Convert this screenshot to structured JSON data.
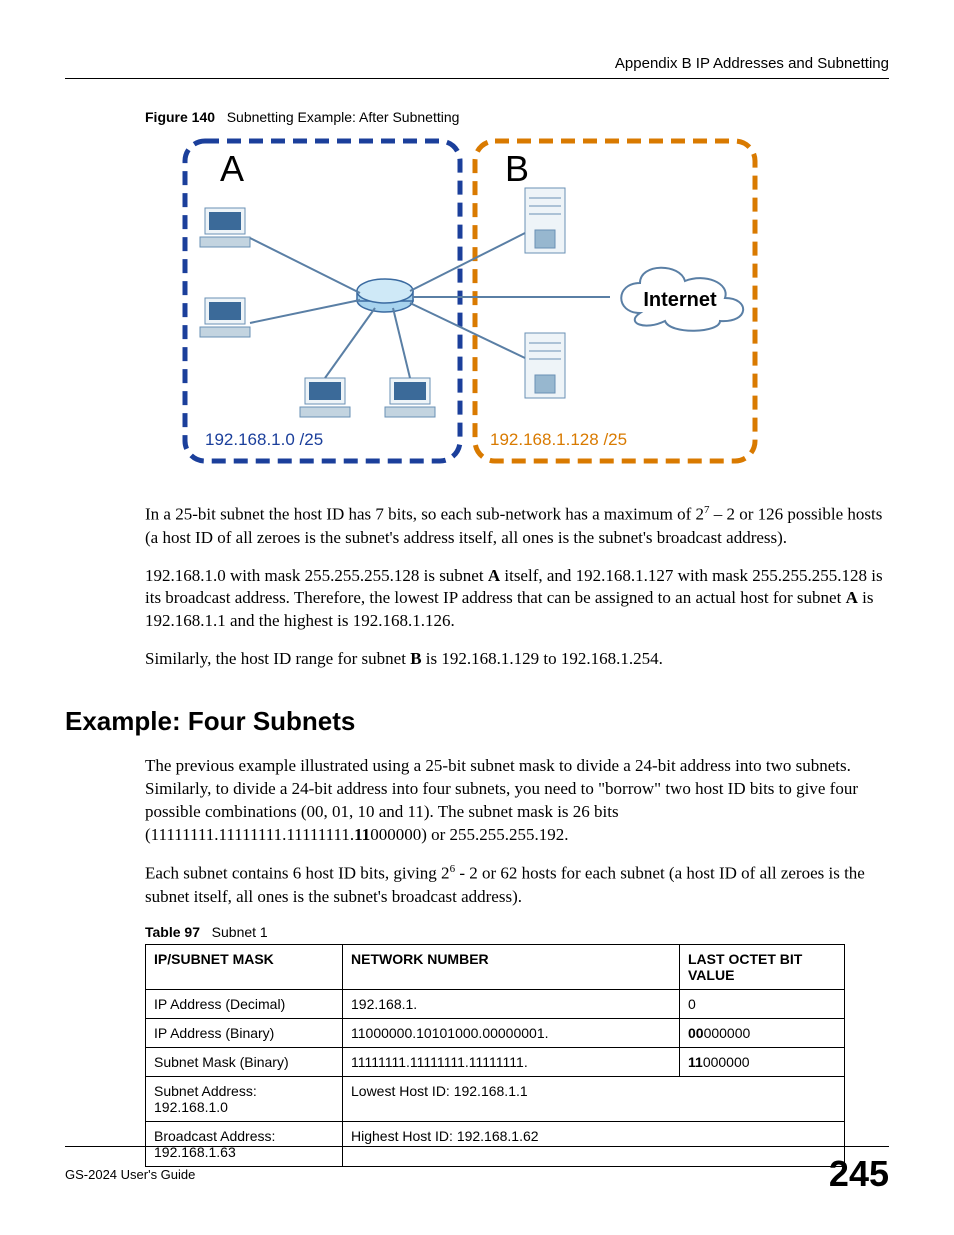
{
  "header": {
    "appendix_line": "Appendix B IP Addresses and Subnetting"
  },
  "figure": {
    "label": "Figure 140",
    "title": "Subnetting Example: After Subnetting",
    "box_a": "A",
    "box_b": "B",
    "subnet_a_ip": "192.168.1.0 /25",
    "subnet_b_ip": "192.168.1.128 /25",
    "cloud_label": "Internet"
  },
  "paragraphs": {
    "p1_a": "In a 25-bit subnet the host ID has 7 bits, so each sub-network has a maximum of 2",
    "p1_sup": "7",
    "p1_b": " – 2 or 126 possible hosts (a host ID of all zeroes is the subnet's address itself, all ones is the subnet's broadcast address).",
    "p2_a": "192.168.1.0 with mask 255.255.255.128 is subnet ",
    "p2_bold1": "A",
    "p2_b": " itself, and 192.168.1.127 with mask 255.255.255.128 is its broadcast address. Therefore, the lowest IP address that can be assigned to an actual host for subnet ",
    "p2_bold2": "A",
    "p2_c": " is 192.168.1.1 and the highest is 192.168.1.126.",
    "p3_a": "Similarly, the host ID range for subnet ",
    "p3_bold": "B",
    "p3_b": " is 192.168.1.129 to 192.168.1.254."
  },
  "section_heading": "Example: Four Subnets",
  "paragraphs2": {
    "p4_a": "The previous example illustrated using a 25-bit subnet mask to divide a 24-bit address into two subnets. Similarly, to divide a 24-bit address into four subnets, you need to \"borrow\" two host ID bits to give four possible combinations (00, 01, 10 and 11). The subnet mask is 26 bits (11111111.11111111.11111111.",
    "p4_bold": "11",
    "p4_b": "000000) or 255.255.255.192.",
    "p5_a": "Each subnet contains 6 host ID bits, giving 2",
    "p5_sup": "6",
    "p5_b": " - 2 or 62 hosts for each subnet (a host ID of all zeroes is the subnet itself, all ones is the subnet's broadcast address)."
  },
  "table": {
    "label": "Table 97",
    "title": "Subnet 1",
    "headers": {
      "h1": "IP/SUBNET MASK",
      "h2": "NETWORK NUMBER",
      "h3": "LAST OCTET BIT VALUE"
    },
    "rows": [
      {
        "c1": "IP Address (Decimal)",
        "c2": "192.168.1.",
        "c3_bold": "",
        "c3_rest": "0"
      },
      {
        "c1": "IP Address (Binary)",
        "c2": "11000000.10101000.00000001.",
        "c3_bold": "00",
        "c3_rest": "000000"
      },
      {
        "c1": "Subnet Mask (Binary)",
        "c2": "11111111.11111111.11111111.",
        "c3_bold": "11",
        "c3_rest": "000000"
      }
    ],
    "span_rows": [
      {
        "c1": "Subnet Address: 192.168.1.0",
        "c2span": "Lowest Host ID: 192.168.1.1"
      },
      {
        "c1": "Broadcast Address: 192.168.1.63",
        "c2span": "Highest Host ID: 192.168.1.62"
      }
    ]
  },
  "footer": {
    "left": "GS-2024 User's Guide",
    "right": "245"
  }
}
